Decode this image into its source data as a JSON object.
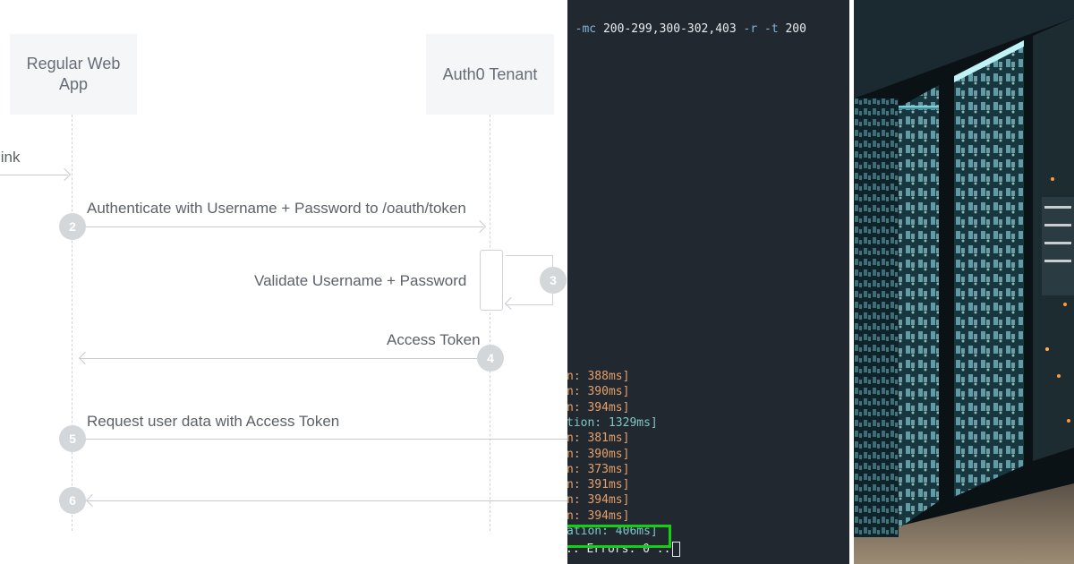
{
  "diagram": {
    "actors": [
      {
        "line1": "Regular Web",
        "line2": "App"
      },
      {
        "line1": "Auth0 Tenant",
        "line2": ""
      }
    ],
    "messages": {
      "m1": {
        "label": "link"
      },
      "m2": {
        "step": "2",
        "label": "Authenticate with Username + Password to /oauth/token"
      },
      "m3": {
        "step": "3",
        "label": "Validate Username + Password"
      },
      "m4": {
        "step": "4",
        "label": "Access Token"
      },
      "m5": {
        "step": "5",
        "label": "Request user data with Access Token"
      },
      "m6": {
        "step": "6",
        "label": ""
      }
    }
  },
  "terminal": {
    "command": {
      "prefix": "t ",
      "flag_mc": "-mc",
      "codes": " 200-299,300-302,403 ",
      "flag_r": "-r",
      "flag_t": "-t",
      "t_value": " 200"
    },
    "output_lines": [
      {
        "text": "n: 388ms]",
        "color": "orange"
      },
      {
        "text": "n: 390ms]",
        "color": "orange"
      },
      {
        "text": "n: 394ms]",
        "color": "orange"
      },
      {
        "text": "tion: 1329ms]",
        "color": "teal"
      },
      {
        "text": "n: 381ms]",
        "color": "orange"
      },
      {
        "text": "n: 390ms]",
        "color": "orange"
      },
      {
        "text": "n: 373ms]",
        "color": "orange"
      },
      {
        "text": "n: 391ms]",
        "color": "orange"
      },
      {
        "text": "n: 394ms]",
        "color": "orange"
      },
      {
        "text": "n: 394ms]",
        "color": "orange"
      },
      {
        "text": "ation: 406ms]",
        "color": "teal"
      }
    ],
    "status_line": ":: Errors: 0 ::",
    "highlight_color": "#14d014"
  },
  "artwork": {
    "subject": "server-room-hieroglyph-artwork"
  }
}
